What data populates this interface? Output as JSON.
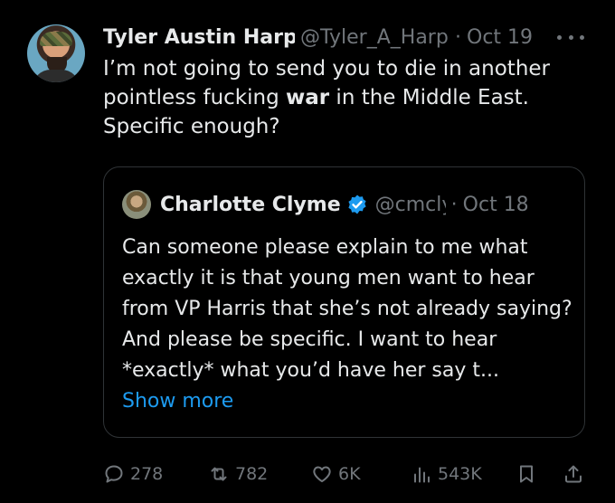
{
  "tweet": {
    "author_name": "Tyler Austin Harper",
    "handle": "@Tyler_A_Harper",
    "separator": "·",
    "date": "Oct 19",
    "text_before": "I’m not going to send you to die in another pointless fucking ",
    "text_bold": "war",
    "text_after": " in the Middle East. Specific enough?"
  },
  "quoted": {
    "author_name": "Charlotte Clyme",
    "handle": "@cmclymer",
    "separator": "·",
    "date": "Oct 18",
    "text": "Can someone please explain to me what exactly it is that young men want to hear from VP Harris that she’s not already saying? And please be specific. I want to hear *exactly* what you’d have her say t...",
    "show_more": "Show more"
  },
  "actions": {
    "replies": "278",
    "reposts": "782",
    "likes": "6K",
    "views": "543K"
  },
  "colors": {
    "background": "#000000",
    "text": "#e7e9ea",
    "muted": "#71767b",
    "link": "#1d9bf0",
    "verified": "#1d9bf0"
  }
}
